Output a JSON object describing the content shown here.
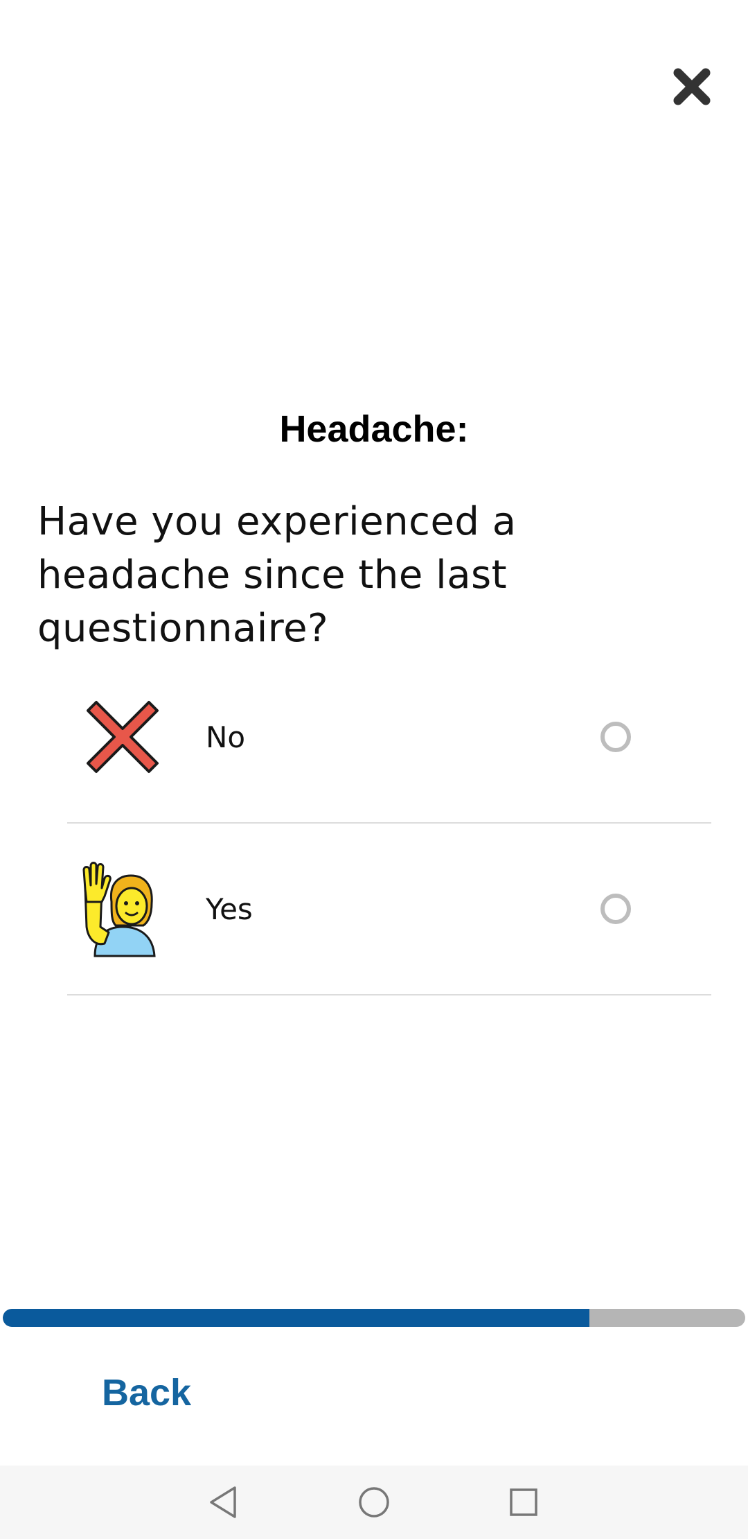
{
  "header": {
    "close_icon": "close-icon"
  },
  "question": {
    "title": "Headache:",
    "text": "Have you experienced a headache since the last questionnaire?"
  },
  "options": [
    {
      "label": "No",
      "icon": "red-cross-mark-icon",
      "selected": false
    },
    {
      "label": "Yes",
      "icon": "person-raising-hand-icon",
      "selected": false
    }
  ],
  "progress": {
    "fraction": 0.79,
    "fill_color": "#0a5a9c",
    "track_color": "#b5b5b5"
  },
  "footer": {
    "back_label": "Back",
    "back_color": "#1565a0"
  },
  "system_nav": {
    "back_icon": "nav-back-icon",
    "home_icon": "nav-home-icon",
    "recents_icon": "nav-recents-icon"
  }
}
